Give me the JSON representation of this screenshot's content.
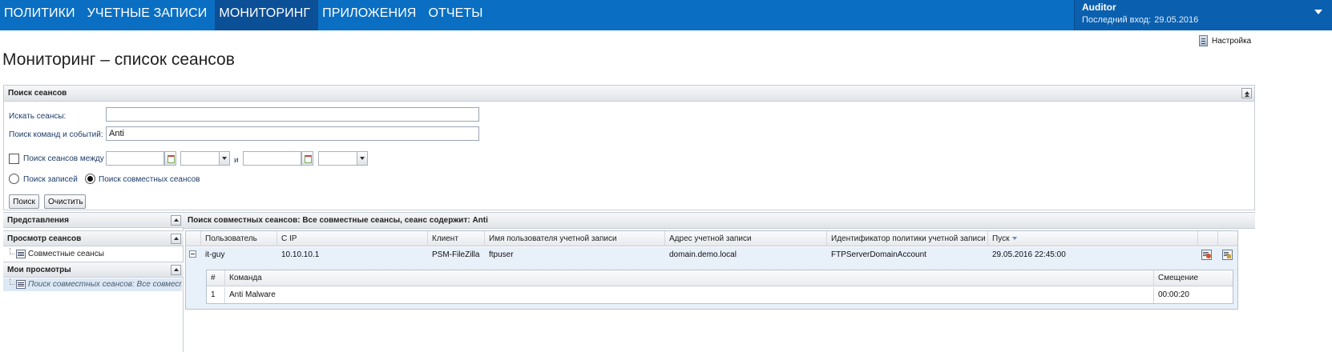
{
  "nav": {
    "items": [
      "ПОЛИТИКИ",
      "УЧЕТНЫЕ ЗАПИСИ",
      "МОНИТОРИНГ",
      "ПРИЛОЖЕНИЯ",
      "ОТЧЕТЫ"
    ],
    "active": "МОНИТОРИНГ"
  },
  "user": {
    "name": "Auditor",
    "last_login_label": "Последний вход:",
    "last_login_date": "29.05.2016"
  },
  "settings_label": "Настройка",
  "page_title": "Мониторинг – список сеансов",
  "search": {
    "title": "Поиск сеансов",
    "sessions_label": "Искать сеансы:",
    "sessions_value": "",
    "commands_label": "Поиск команд и событий:",
    "commands_value": "Anti",
    "between_label": "Поиск сеансов между",
    "and_label": "и",
    "radio_records": "Поиск записей",
    "radio_shared": "Поиск совместных сеансов",
    "search_button": "Поиск",
    "clear_button": "Очистить"
  },
  "left": {
    "views_title": "Представления",
    "session_view_title": "Просмотр сеансов",
    "session_view_item": "Совместные сеансы",
    "my_views_title": "Мои просмотры",
    "my_views_item": "Поиск совместных сеансов: Все совместные сеансы"
  },
  "results": {
    "title": "Поиск совместных сеансов: Все совместные сеансы, сеанс содержит: Anti",
    "columns": [
      "Пользователь",
      "С IP",
      "Клиент",
      "Имя пользователя учетной записи",
      "Адрес учетной записи",
      "Идентификатор политики учетной записи",
      "Пуск"
    ],
    "row": {
      "user": "it-guy",
      "ip": "10.10.10.1",
      "client": "PSM-FileZilla",
      "account_user": "ftpuser",
      "account_address": "domain.demo.local",
      "policy_id": "FTPServerDomainAccount",
      "start": "29.05.2016 22:45:00"
    },
    "sub_columns": [
      "#",
      "Команда",
      "Смещение"
    ],
    "sub_row": {
      "num": "1",
      "command": "Anti Malware",
      "offset": "00:00:20"
    }
  },
  "colors": {
    "nav_bg": "#0a6fc2",
    "nav_active": "#0b4f97",
    "row_bg": "#e8f0f9"
  }
}
